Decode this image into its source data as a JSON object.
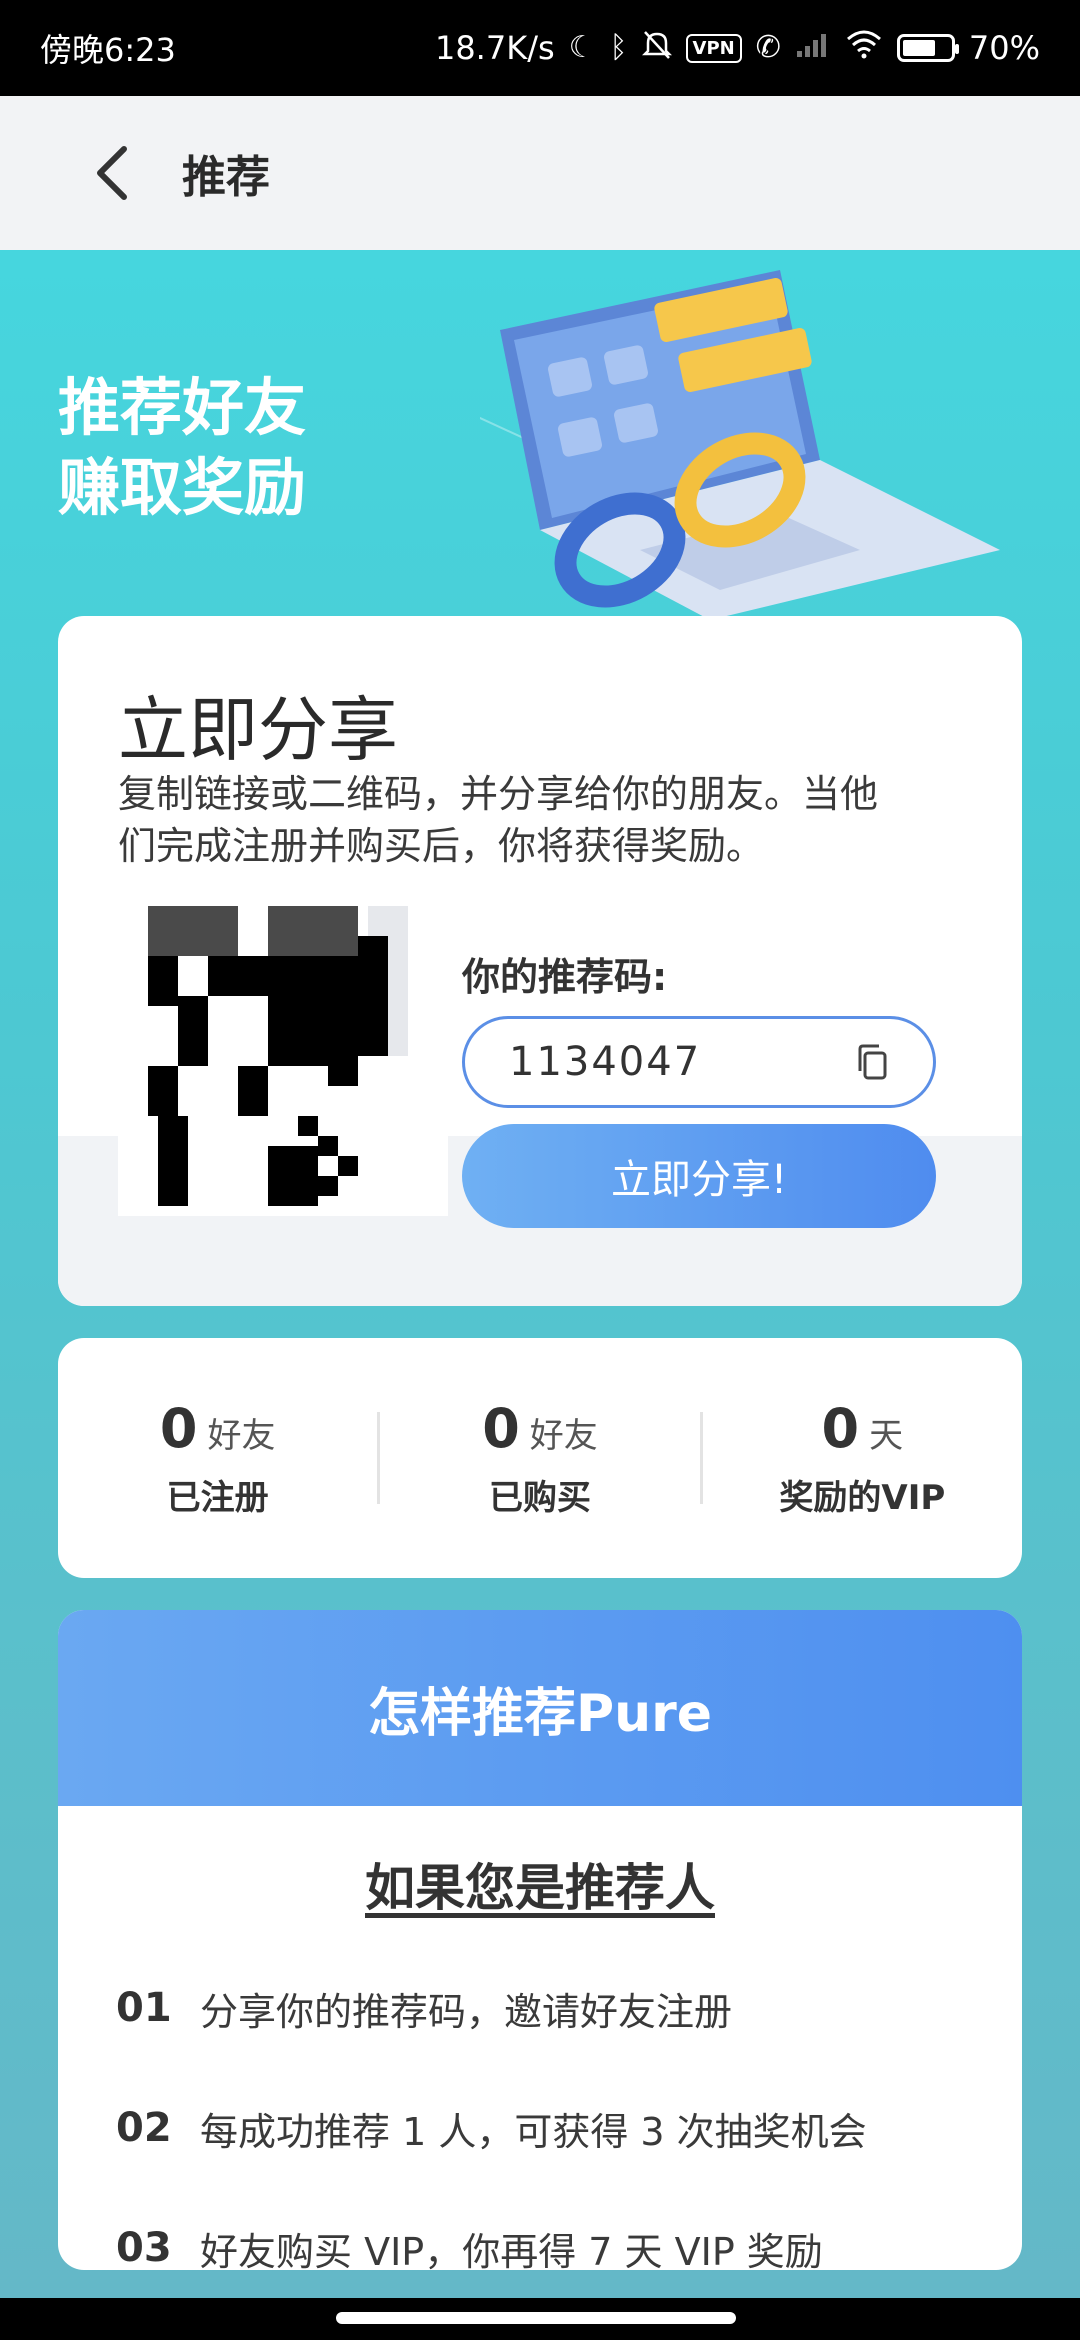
{
  "status_bar": {
    "time": "傍晚6:23",
    "net_speed": "18.7K/s",
    "vpn": "VPN",
    "battery_text": "70%",
    "battery_level": 0.7,
    "icons": [
      "moon-icon",
      "bluetooth-icon",
      "mute-bell-icon",
      "vpn-icon",
      "call-forward-icon",
      "signal-icon",
      "wifi-icon",
      "battery-icon"
    ]
  },
  "header": {
    "title": "推荐"
  },
  "hero": {
    "line1": "推荐好友",
    "line2": "赚取奖励"
  },
  "share": {
    "title": "立即分享",
    "desc_line1": "复制链接或二维码，并分享给你的朋友。当他",
    "desc_line2": "们完成注册并购买后，你将获得奖励。",
    "code_label": "你的推荐码:",
    "code_value": "1134047",
    "button": "立即分享!"
  },
  "stats": [
    {
      "number": "0",
      "unit": "好友",
      "label": "已注册"
    },
    {
      "number": "0",
      "unit": "好友",
      "label": "已购买"
    },
    {
      "number": "0",
      "unit": "天",
      "label": "奖励的VIP"
    }
  ],
  "howto": {
    "title": "怎样推荐Pure",
    "subtitle": "如果您是推荐人",
    "steps": [
      {
        "num": "01",
        "text": "分享你的推荐码，邀请好友注册"
      },
      {
        "num": "02",
        "text": "每成功推荐 1 人，可获得 3 次抽奖机会"
      },
      {
        "num": "03",
        "text": "好友购买 VIP，你再得 7 天 VIP 奖励"
      }
    ]
  },
  "colors": {
    "teal": "#46d6de",
    "accent_blue": "#4f8cef",
    "card": "#ffffff"
  }
}
